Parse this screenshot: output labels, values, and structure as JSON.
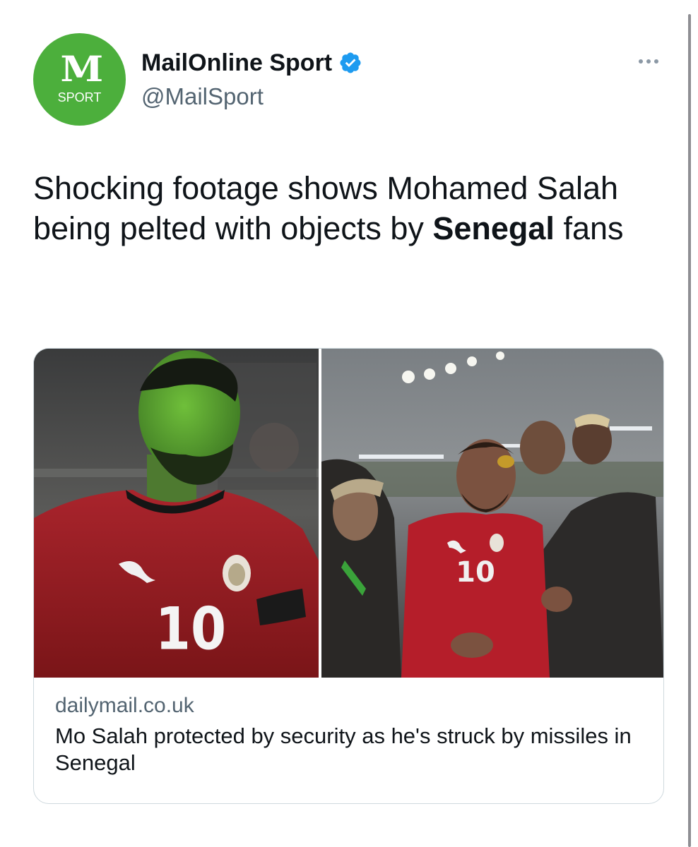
{
  "author": {
    "avatar_logo": "M",
    "avatar_label": "SPORT",
    "name": "MailOnline Sport",
    "handle": "@MailSport",
    "verified": true
  },
  "tweet": {
    "text_before": "Shocking footage shows Mohamed Salah being pelted with objects by ",
    "text_bold": "Senegal",
    "text_after": " fans"
  },
  "card": {
    "domain": "dailymail.co.uk",
    "title": "Mo Salah protected by security as he's struck by missiles in Senegal",
    "left_image": {
      "shirt_number": "10"
    },
    "right_image": {
      "shirt_number": "10"
    }
  },
  "icons": {
    "verified": "verified-badge-icon",
    "more": "more-options-icon"
  },
  "colors": {
    "avatar_bg": "#4caf3c",
    "verified_blue": "#1d9bf0",
    "secondary_text": "#536471",
    "card_border": "#cfd9de"
  }
}
